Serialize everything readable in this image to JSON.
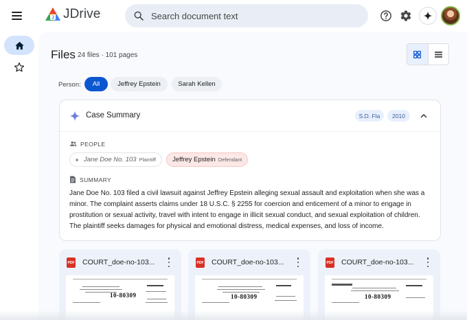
{
  "app": {
    "name": "JDrive"
  },
  "search": {
    "placeholder": "Search document text"
  },
  "colors": {
    "accent": "#0b57d0",
    "defendant_chip": "#fce8e6",
    "tag_bg": "#e8f0fe",
    "pdf_red": "#d93025"
  },
  "header_icons": [
    "menu-icon",
    "help-icon",
    "gear-icon",
    "sparkle-icon",
    "avatar"
  ],
  "rail": {
    "items": [
      {
        "icon": "home-icon",
        "active": true
      },
      {
        "icon": "star-icon",
        "active": false
      }
    ]
  },
  "page": {
    "title": "Files",
    "meta": "24 files · 101 pages"
  },
  "view": {
    "active": "grid"
  },
  "filters": {
    "label": "Person:",
    "options": [
      "All",
      "Jeffrey Epstein",
      "Sarah Kellen"
    ],
    "selected": "All"
  },
  "case_summary": {
    "title": "Case Summary",
    "tags": [
      "S.D. Fla",
      "2010"
    ],
    "people_label": "PEOPLE",
    "people": [
      {
        "name": "Jane Doe No. 103",
        "role": "Plaintiff"
      },
      {
        "name": "Jeffrey Epstein",
        "role": "Defendant"
      }
    ],
    "summary_label": "SUMMARY",
    "summary_text": "Jane Doe No. 103 filed a civil lawsuit against Jeffrey Epstein alleging sexual assault and exploitation when she was a minor. The complaint asserts claims under 18 U.S.C. § 2255 for coercion and enticement of a minor to engage in prostitution or sexual activity, travel with intent to engage in illicit sexual conduct, and sexual exploitation of children. The plaintiff seeks damages for physical and emotional distress, medical expenses, and loss of income."
  },
  "documents": [
    {
      "name": "COURT_doe-no-103...",
      "thumb_number": "10-80309"
    },
    {
      "name": "COURT_doe-no-103...",
      "thumb_number": "10-80309"
    },
    {
      "name": "COURT_doe-no-103...",
      "thumb_number": "10-80309"
    }
  ]
}
